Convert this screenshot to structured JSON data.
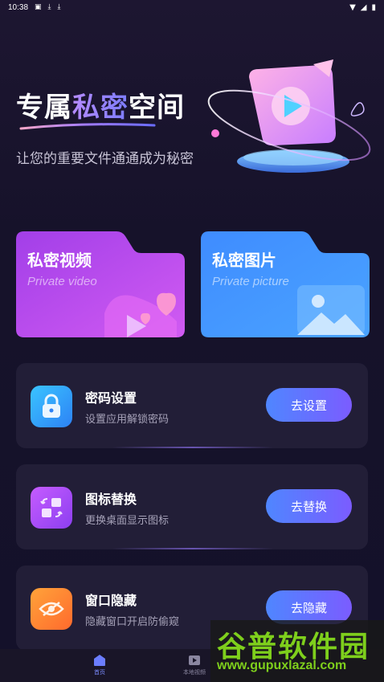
{
  "status_bar": {
    "time": "10:38",
    "icons": [
      "notification-a-icon",
      "download-icon",
      "download-icon"
    ],
    "right_icons": [
      "wifi-icon",
      "signal-icon",
      "battery-icon"
    ]
  },
  "hero": {
    "title_pre": "专属",
    "title_accent": "私密",
    "title_post": "空间",
    "subtitle": "让您的重要文件通通成为秘密"
  },
  "folders": [
    {
      "title": "私密视频",
      "subtitle": "Private video",
      "color": "#b24cf5"
    },
    {
      "title": "私密图片",
      "subtitle": "Private picture",
      "color": "#3d8bff"
    }
  ],
  "cards": [
    {
      "title": "密码设置",
      "desc": "设置应用解锁密码",
      "button": "去设置",
      "icon": "lock-icon"
    },
    {
      "title": "图标替换",
      "desc": "更换桌面显示图标",
      "button": "去替换",
      "icon": "swap-icon"
    },
    {
      "title": "窗口隐藏",
      "desc": "隐藏窗口开启防偷窥",
      "button": "去隐藏",
      "icon": "eye-hide-icon"
    }
  ],
  "bottom_nav": [
    {
      "label": "首页",
      "icon": "home-icon",
      "active": true
    },
    {
      "label": "本地视频",
      "icon": "video-icon",
      "active": false
    }
  ],
  "watermark": {
    "brand": "谷普软件园",
    "url": "www.gupuxlazal.com"
  },
  "colors": {
    "button_start": "#4f86ff",
    "button_end": "#7b5cff",
    "card_bg": "#221e37"
  }
}
